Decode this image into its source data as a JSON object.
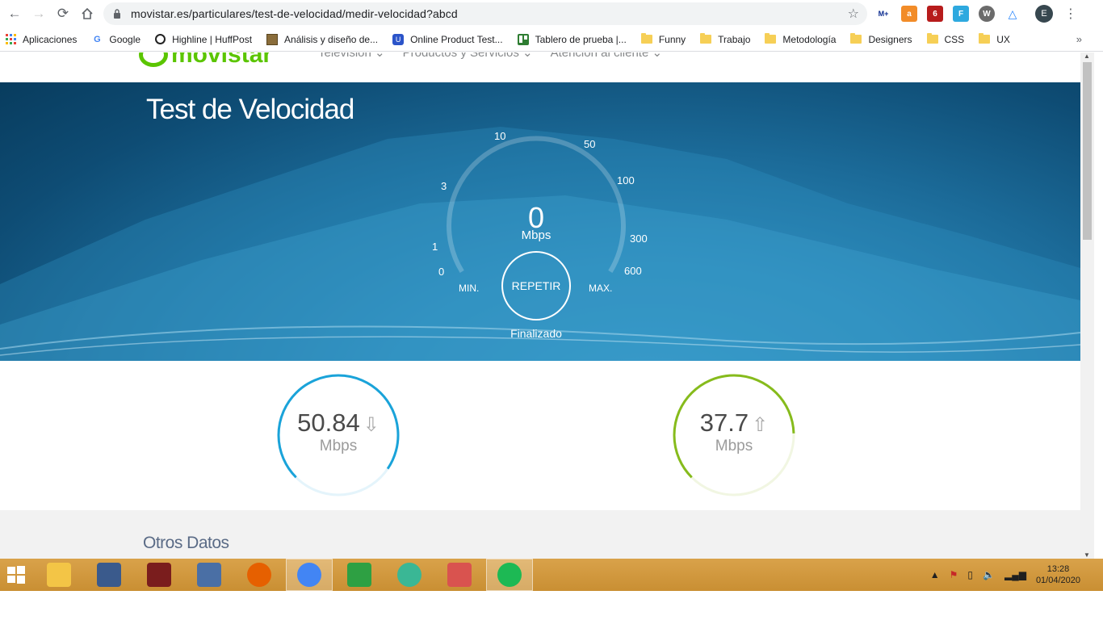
{
  "browser": {
    "url": "movistar.es/particulares/test-de-velocidad/medir-velocidad?abcd",
    "extensions": [
      {
        "name": "movistar-plus-extension",
        "label": "M+",
        "color": "#0b2b8f"
      },
      {
        "name": "shopping-extension",
        "label": "a",
        "color": "#f28c28"
      },
      {
        "name": "ublock-extension",
        "label": "6",
        "color": "#b71c1c"
      },
      {
        "name": "feedly-extension",
        "label": "F",
        "color": "#2ea9df"
      },
      {
        "name": "wappalyzer-extension",
        "label": "W",
        "color": "#6b6b6b"
      },
      {
        "name": "drive-extension",
        "label": "△",
        "color": "#2684fc"
      }
    ],
    "profile_initial": "E"
  },
  "bookmarks": [
    {
      "name": "bookmark-apps",
      "label": "Aplicaciones",
      "icon": "apps-grid-icon"
    },
    {
      "name": "bookmark-google",
      "label": "Google",
      "icon": "google-icon"
    },
    {
      "name": "bookmark-huffpost",
      "label": "Highline | HuffPost",
      "icon": "huffpost-icon"
    },
    {
      "name": "bookmark-analisis",
      "label": "Análisis y diseño de...",
      "icon": "page-icon"
    },
    {
      "name": "bookmark-online-product",
      "label": "Online Product Test...",
      "icon": "usertesting-icon"
    },
    {
      "name": "bookmark-tablero",
      "label": "Tablero de prueba |...",
      "icon": "trello-icon"
    },
    {
      "name": "bookmark-funny",
      "label": "Funny",
      "icon": "folder-icon"
    },
    {
      "name": "bookmark-trabajo",
      "label": "Trabajo",
      "icon": "folder-icon"
    },
    {
      "name": "bookmark-metodologia",
      "label": "Metodología",
      "icon": "folder-icon"
    },
    {
      "name": "bookmark-designers",
      "label": "Designers",
      "icon": "folder-icon"
    },
    {
      "name": "bookmark-css",
      "label": "CSS",
      "icon": "folder-icon"
    },
    {
      "name": "bookmark-ux",
      "label": "UX",
      "icon": "folder-icon"
    }
  ],
  "site": {
    "logo_text": "movistar",
    "nav": [
      "Televisión ⌄",
      "Productos y Servicios ⌄",
      "Atención al cliente ⌄"
    ]
  },
  "speedtest": {
    "title": "Test de Velocidad",
    "gauge_value": "0",
    "gauge_unit": "Mbps",
    "scale": [
      "0",
      "1",
      "3",
      "10",
      "50",
      "100",
      "300",
      "600"
    ],
    "min_label": "MIN.",
    "max_label": "MAX.",
    "repeat_label": "REPETIR",
    "status": "Finalizado",
    "download": {
      "value": "50.84",
      "unit": "Mbps",
      "color": "#1aa3d9",
      "arrow": "⇩",
      "fill": 0.72
    },
    "upload": {
      "value": "37.7",
      "unit": "Mbps",
      "color": "#86bb1c",
      "arrow": "⇧",
      "fill": 0.62
    }
  },
  "other_section": {
    "title": "Otros Datos"
  },
  "taskbar": {
    "apps": [
      {
        "name": "file-explorer-app",
        "icon": "folder-icon",
        "color": "#f3c546"
      },
      {
        "name": "remote-desktop-app",
        "icon": "monitor-icon",
        "color": "#3a5a8c"
      },
      {
        "name": "media-player-app",
        "icon": "media-icon",
        "color": "#7a1d1d"
      },
      {
        "name": "remote-connection-app",
        "icon": "screen-icon",
        "color": "#4a6fa5"
      },
      {
        "name": "firefox-app",
        "icon": "firefox-icon",
        "color": "#e66000"
      },
      {
        "name": "chrome-app",
        "icon": "chrome-icon",
        "color": "#4285f4",
        "active": true
      },
      {
        "name": "store-app",
        "icon": "store-icon",
        "color": "#2ea043"
      },
      {
        "name": "atom-app",
        "icon": "atom-icon",
        "color": "#3ab795"
      },
      {
        "name": "snipping-app",
        "icon": "scissors-icon",
        "color": "#d9534f"
      },
      {
        "name": "spotify-app",
        "icon": "spotify-icon",
        "color": "#1db954",
        "active": true
      }
    ],
    "time": "13:28",
    "date": "01/04/2020"
  }
}
